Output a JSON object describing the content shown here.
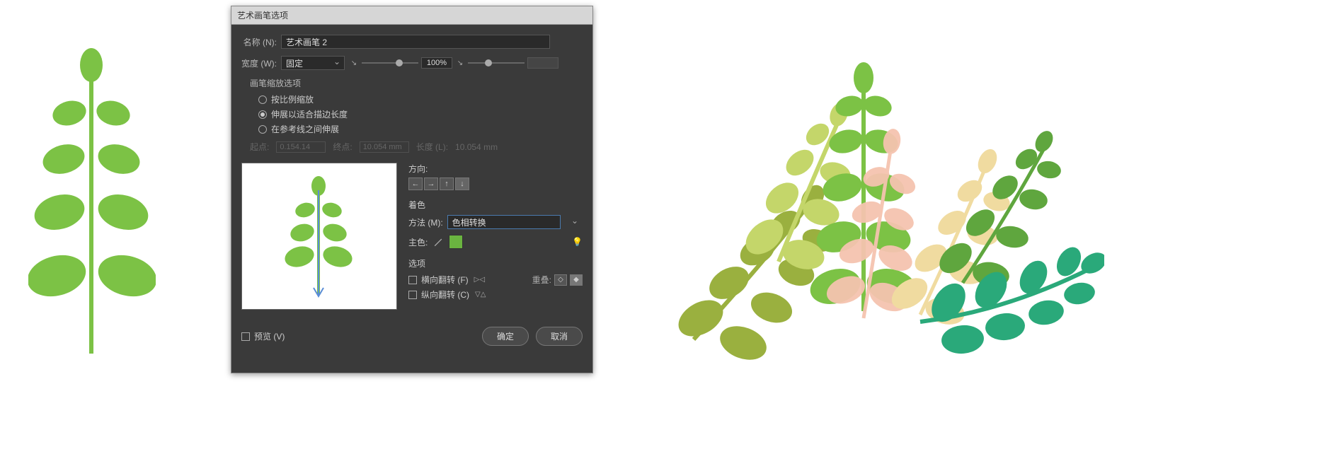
{
  "dialog": {
    "title": "艺术画笔选项",
    "name_label": "名称 (N):",
    "name_value": "艺术画笔 2",
    "width_label": "宽度 (W):",
    "width_mode": "固定",
    "width_pct": "100%",
    "scale_section": "画笔缩放选项",
    "scale_options": {
      "proportional": "按比例缩放",
      "stretch": "伸展以适合描边长度",
      "between": "在参考线之间伸展"
    },
    "disabled_fit": {
      "start_label": "起点:",
      "start_value": "0.154.14",
      "end_label": "终点:",
      "end_value": "10.054 mm",
      "length_label": "长度 (L):",
      "length_value": "10.054 mm"
    },
    "direction_label": "方向:",
    "colorize_label": "着色",
    "method_label": "方法 (M):",
    "method_value": "色相转换",
    "key_color_label": "主色:",
    "key_color_hex": "#6ab440",
    "options_label": "选项",
    "flip_h": "横向翻转 (F)",
    "flip_v": "纵向翻转 (C)",
    "overlap_label": "重叠:",
    "preview_label": "预览 (V)",
    "ok": "确定",
    "cancel": "取消"
  },
  "colors": {
    "green": "#7cc245",
    "olive": "#9ab03f",
    "lime": "#c4d66a",
    "pink": "#f5c4af",
    "cream": "#f0dba0",
    "teal": "#2aa97a",
    "darkgreen": "#5fa63e"
  }
}
